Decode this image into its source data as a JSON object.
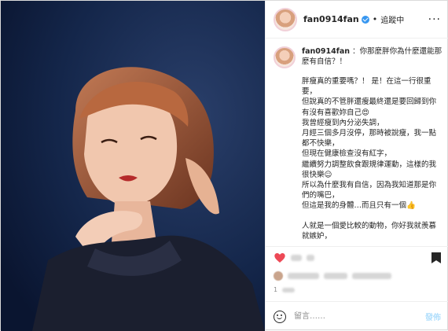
{
  "header": {
    "username": "fan0914fan",
    "dot": "•",
    "follow_label": "追蹤中",
    "more_icon": "more-horizontal-icon"
  },
  "caption": {
    "username": "fan0914fan",
    "intro": "：你那麼胖你為什麼還能那麼有自信？！",
    "lines": [
      "胖瘦真的重要嗎？！ 是！在這一行很重要，",
      "但說真的不管胖還瘦最終還是要回歸到你有沒有喜歡妳自己😍",
      "我曾經瘦到內分泌失調，",
      "月經三個多月沒停，那時被說瘦，我一點都不快樂，",
      "但現在健康檢查沒有紅字，",
      "繼續努力調整飲食跟規律運動，這樣的我很快樂☺",
      "所以為什麼我有自信，因為我知道那是你們的嘴巴，",
      "但這是我的身體…而且只有一個👍"
    ],
    "lines2": [
      "人就是一個愛比較的動物，你好我就羨慕就嫉妒，"
    ]
  },
  "actions": {
    "like_icon": "heart-icon",
    "save_icon": "bookmark-icon",
    "heart_color": "#ed4956"
  },
  "time_prefix": "1",
  "comment": {
    "emoji_icon": "smile-icon",
    "placeholder": "留言……",
    "post_label": "發佈"
  }
}
